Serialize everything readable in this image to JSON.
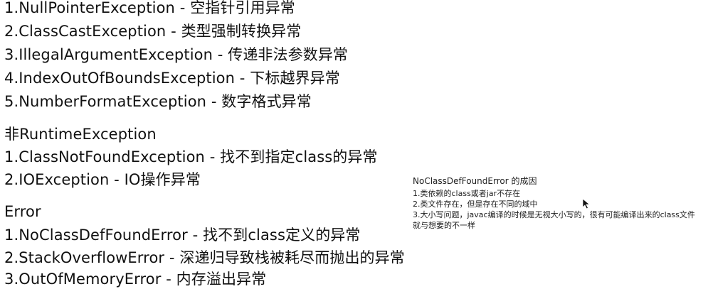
{
  "runtime_list": [
    "1.NullPointerException - 空指针引用异常",
    "2.ClassCastException - 类型强制转换异常",
    "3.IllegalArgumentException - 传递非法参数异常",
    "4.IndexOutOfBoundsException - 下标越界异常",
    "5.NumberFormatException - 数字格式异常"
  ],
  "non_runtime": {
    "heading": "非RuntimeException",
    "items": [
      "1.ClassNotFoundException - 找不到指定class的异常",
      "2.IOException - IO操作异常"
    ]
  },
  "error": {
    "heading": "Error",
    "items": [
      "1.NoClassDefFoundError - 找不到class定义的异常",
      "2.StackOverflowError - 深递归导致栈被耗尽而抛出的异常",
      "3.OutOfMemoryError - 内存溢出异常"
    ]
  },
  "note": {
    "title": "NoClassDefFoundError 的成因",
    "lines": [
      "1.类依赖的class或者jar不存在",
      "2.类文件存在，但是存在不同的域中",
      "3.大小写问题，javac编译的时候是无视大小写的，很有可能编译出来的class文件就与想要的不一样"
    ]
  },
  "icons": {
    "cursor": "mouse-pointer-icon"
  }
}
